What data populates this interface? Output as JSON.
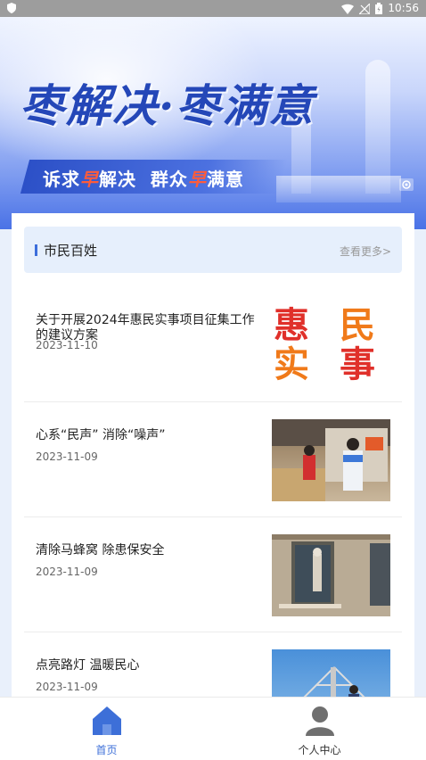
{
  "status_bar": {
    "time": "10:56"
  },
  "banner": {
    "slogan": "枣解决·枣满意",
    "subtitle_parts": [
      "诉求",
      "早",
      "解决  群众",
      "早",
      "满意"
    ]
  },
  "section": {
    "title": "市民百姓",
    "more_label": "查看更多>"
  },
  "news": [
    {
      "title": "关于开展2024年惠民实事项目征集工作的建议方案",
      "date": "2023-11-10",
      "thumb_text": [
        "惠",
        "民",
        "实",
        "事"
      ]
    },
    {
      "title": "心系“民声” 消除“噪声”",
      "date": "2023-11-09"
    },
    {
      "title": "清除马蜂窝 除患保安全",
      "date": "2023-11-09"
    },
    {
      "title": "点亮路灯 温暖民心",
      "date": "2023-11-09"
    }
  ],
  "tabbar": {
    "tabs": [
      {
        "label": "首页",
        "active": true
      },
      {
        "label": "个人中心",
        "active": false
      }
    ]
  },
  "colors": {
    "accent": "#3c6ddb",
    "section_bg": "#e6effc",
    "thumb_red": "#e0302a",
    "thumb_orange": "#f07a1a"
  }
}
